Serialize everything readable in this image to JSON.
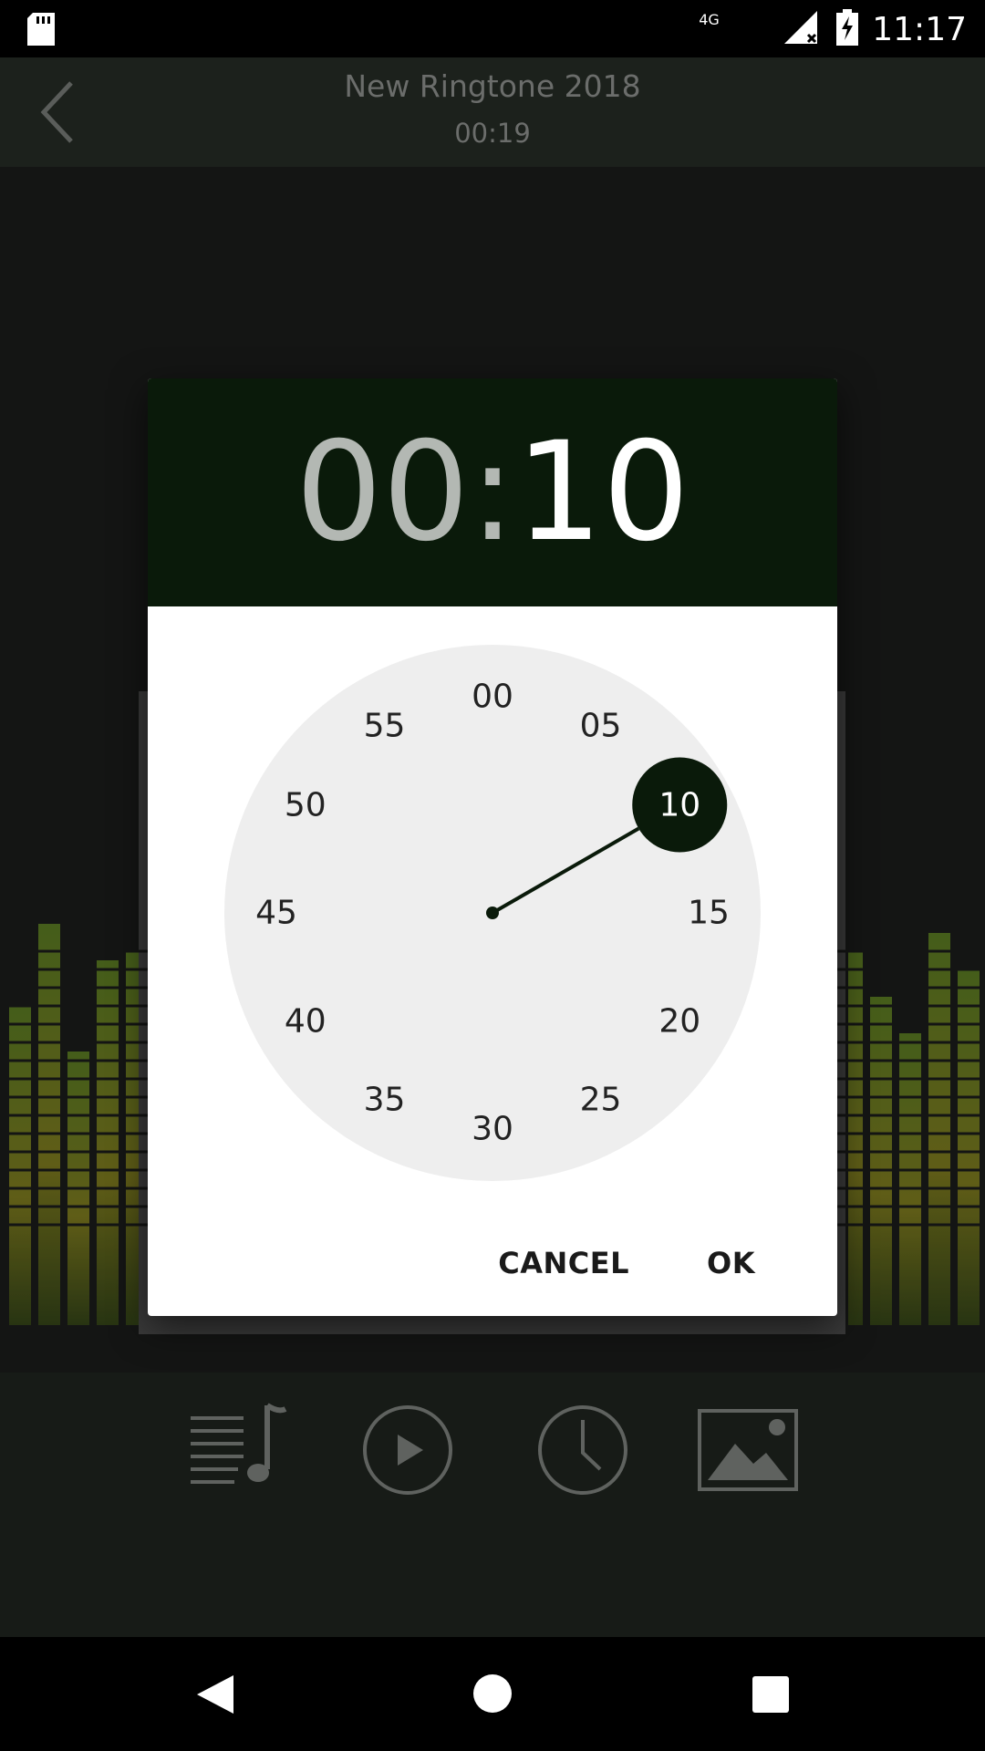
{
  "status_bar": {
    "network": "4G",
    "time": "11:17"
  },
  "header": {
    "title": "New Ringtone 2018",
    "duration": "00:19"
  },
  "dialog": {
    "minutes": "00",
    "colon": ":",
    "seconds": "10",
    "clock_numbers": [
      "00",
      "05",
      "10",
      "15",
      "20",
      "25",
      "30",
      "35",
      "40",
      "45",
      "50",
      "55"
    ],
    "selected": "10",
    "cancel_label": "CANCEL",
    "ok_label": "OK"
  },
  "colors": {
    "header_bg": "#0a1a0a",
    "accent": "#0a1a0a",
    "eq_green": "#8bc34a",
    "eq_yellow": "#c8b22a"
  },
  "toolbar": {
    "icons": [
      "music-list-icon",
      "play-circle-icon",
      "clock-icon",
      "image-icon"
    ]
  },
  "nav": {
    "icons": [
      "back-triangle-icon",
      "home-circle-icon",
      "recents-square-icon"
    ]
  }
}
